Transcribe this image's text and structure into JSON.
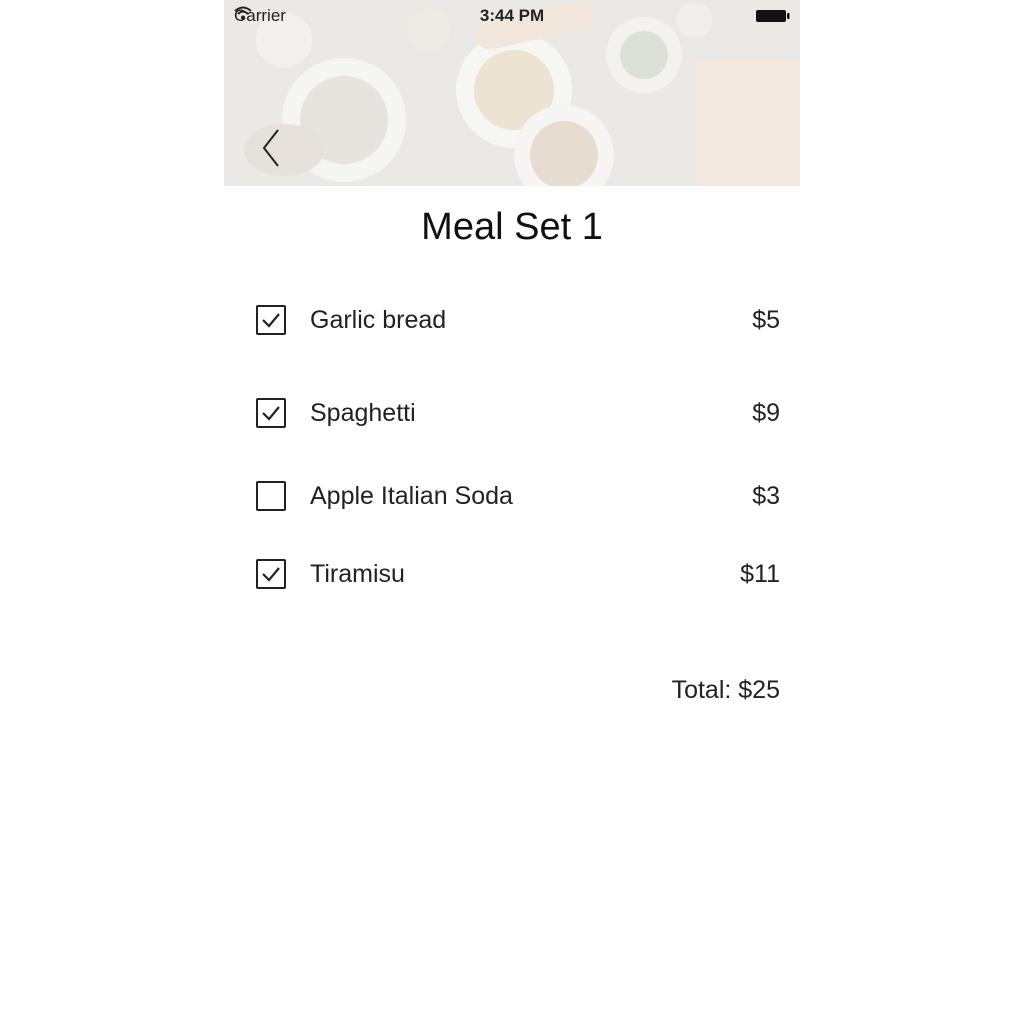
{
  "status_bar": {
    "carrier": "Carrier",
    "time": "3:44 PM"
  },
  "header": {
    "title": "Meal Set 1"
  },
  "items": [
    {
      "name": "Garlic bread",
      "price": "$5",
      "checked": true
    },
    {
      "name": "Spaghetti",
      "price": "$9",
      "checked": true
    },
    {
      "name": "Apple Italian Soda",
      "price": "$3",
      "checked": false
    },
    {
      "name": "Tiramisu",
      "price": "$11",
      "checked": true
    }
  ],
  "total": "Total: $25",
  "icons": {
    "wifi": "wifi-icon",
    "battery": "battery-icon",
    "back": "chevron-left-icon",
    "check": "checkmark-icon"
  }
}
